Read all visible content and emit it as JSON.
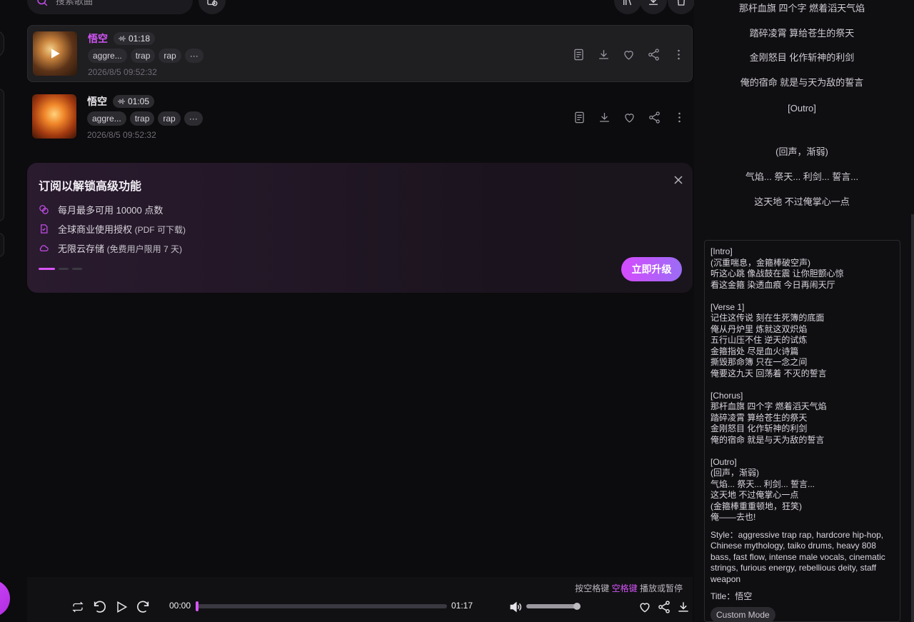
{
  "search": {
    "placeholder": "搜索歌曲"
  },
  "songs": [
    {
      "title": "悟空",
      "duration": "01:18",
      "tags": [
        "aggre...",
        "trap",
        "rap",
        "···"
      ],
      "date": "2026/8/5 09:52:32",
      "active": true
    },
    {
      "title": "悟空",
      "duration": "01:05",
      "tags": [
        "aggre...",
        "trap",
        "rap",
        "···"
      ],
      "date": "2026/8/5 09:52:32",
      "active": false
    }
  ],
  "promo": {
    "title": "订阅以解锁高级功能",
    "features": [
      {
        "text": "每月最多可用 10000 点数",
        "note": ""
      },
      {
        "text": "全球商业使用授权",
        "note": "(PDF 可下载)"
      },
      {
        "text": "无限云存储",
        "note": "(免费用户限用 7 天)"
      }
    ],
    "upgrade_label": "立即升级"
  },
  "player": {
    "hint_prefix": "按空格键",
    "hint_key": "空格键",
    "hint_suffix": "播放或暂停",
    "current_time": "00:00",
    "total_time": "01:17",
    "progress": 0.0,
    "volume": 0.95
  },
  "lyrics_view": [
    "那杆血旗 四个字 燃着滔天气焰",
    "踏碎凌霄 算给苍生的祭天",
    "金刚怒目 化作斩神的利剑",
    "俺的宿命 就是与天为敌的誓言",
    "[Outro]",
    "(回声，渐弱)",
    "气焰... 祭天... 利剑... 誓言...",
    "这天地 不过俺掌心一点"
  ],
  "prompt": {
    "lyrics": "[Intro]\n(沉重喘息，金箍棒破空声)\n听这心跳 像战鼓在震 让你胆颤心惊\n看这金箍 染透血痕 今日再闹天厅\n\n[Verse 1]\n记住这传说 刻在生死簿的底面\n俺从丹炉里 炼就这双炽焰\n五行山压不住 逆天的试炼\n金箍指处 尽是血火诗篇\n撕毁那命簿 只在一念之间\n俺要这九天 回荡着 不灭的誓言\n\n[Chorus]\n那杆血旗 四个字 燃着滔天气焰\n踏碎凌霄 算给苍生的祭天\n金刚怒目 化作斩神的利剑\n俺的宿命 就是与天为敌的誓言\n\n[Outro]\n(回声，渐弱)\n气焰... 祭天... 利剑... 誓言...\n这天地 不过俺掌心一点\n(金箍棒重重顿地，狂笑)\n俺——去也!",
    "style": "Style：aggressive trap rap, hardcore hip-hop, Chinese mythology, taiko drums, heavy 808 bass, fast flow, intense male vocals, cinematic strings, furious energy, rebellious deity, staff weapon",
    "title": "Title：悟空",
    "mode": "Custom Mode"
  },
  "colors": {
    "accent": "#d255f5",
    "bg": "#0c0b0d",
    "panel": "#1f1e21"
  }
}
